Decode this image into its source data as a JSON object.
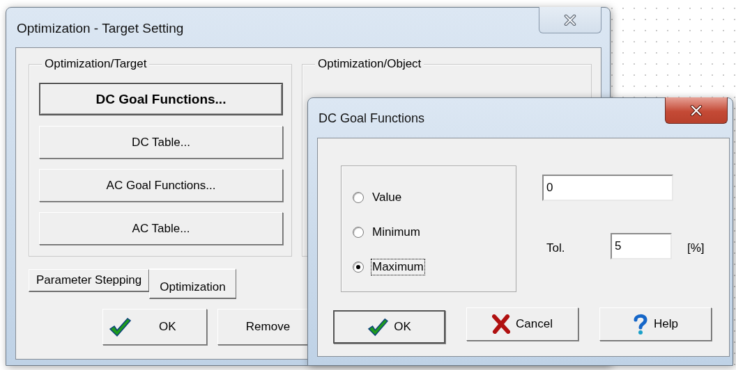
{
  "main_window": {
    "title": "Optimization - Target Setting",
    "groups": [
      {
        "label": "Optimization/Target",
        "buttons": [
          {
            "label": "DC Goal Functions...",
            "default": true
          },
          {
            "label": "DC Table...",
            "default": false
          },
          {
            "label": "AC Goal Functions...",
            "default": false
          },
          {
            "label": "AC Table...",
            "default": false
          }
        ]
      },
      {
        "label": "Optimization/Object"
      }
    ],
    "tabs": [
      {
        "label": "Parameter Stepping",
        "selected": false
      },
      {
        "label": "Optimization",
        "selected": true
      }
    ],
    "buttons": [
      {
        "label": "OK",
        "kind": "check"
      },
      {
        "label": "Remove",
        "kind": "plain"
      }
    ]
  },
  "dialog": {
    "title": "DC Goal Functions",
    "options": [
      {
        "label": "Value",
        "selected": false,
        "focused": false
      },
      {
        "label": "Minimum",
        "selected": false,
        "focused": false
      },
      {
        "label": "Maximum",
        "selected": true,
        "focused": true
      }
    ],
    "value_field": {
      "value": "0"
    },
    "tolerance": {
      "label": "Tol.",
      "value": "5",
      "unit": "[%]"
    },
    "buttons": [
      {
        "label": "OK",
        "kind": "check"
      },
      {
        "label": "Cancel",
        "kind": "cross"
      },
      {
        "label": "Help",
        "kind": "question"
      }
    ]
  }
}
